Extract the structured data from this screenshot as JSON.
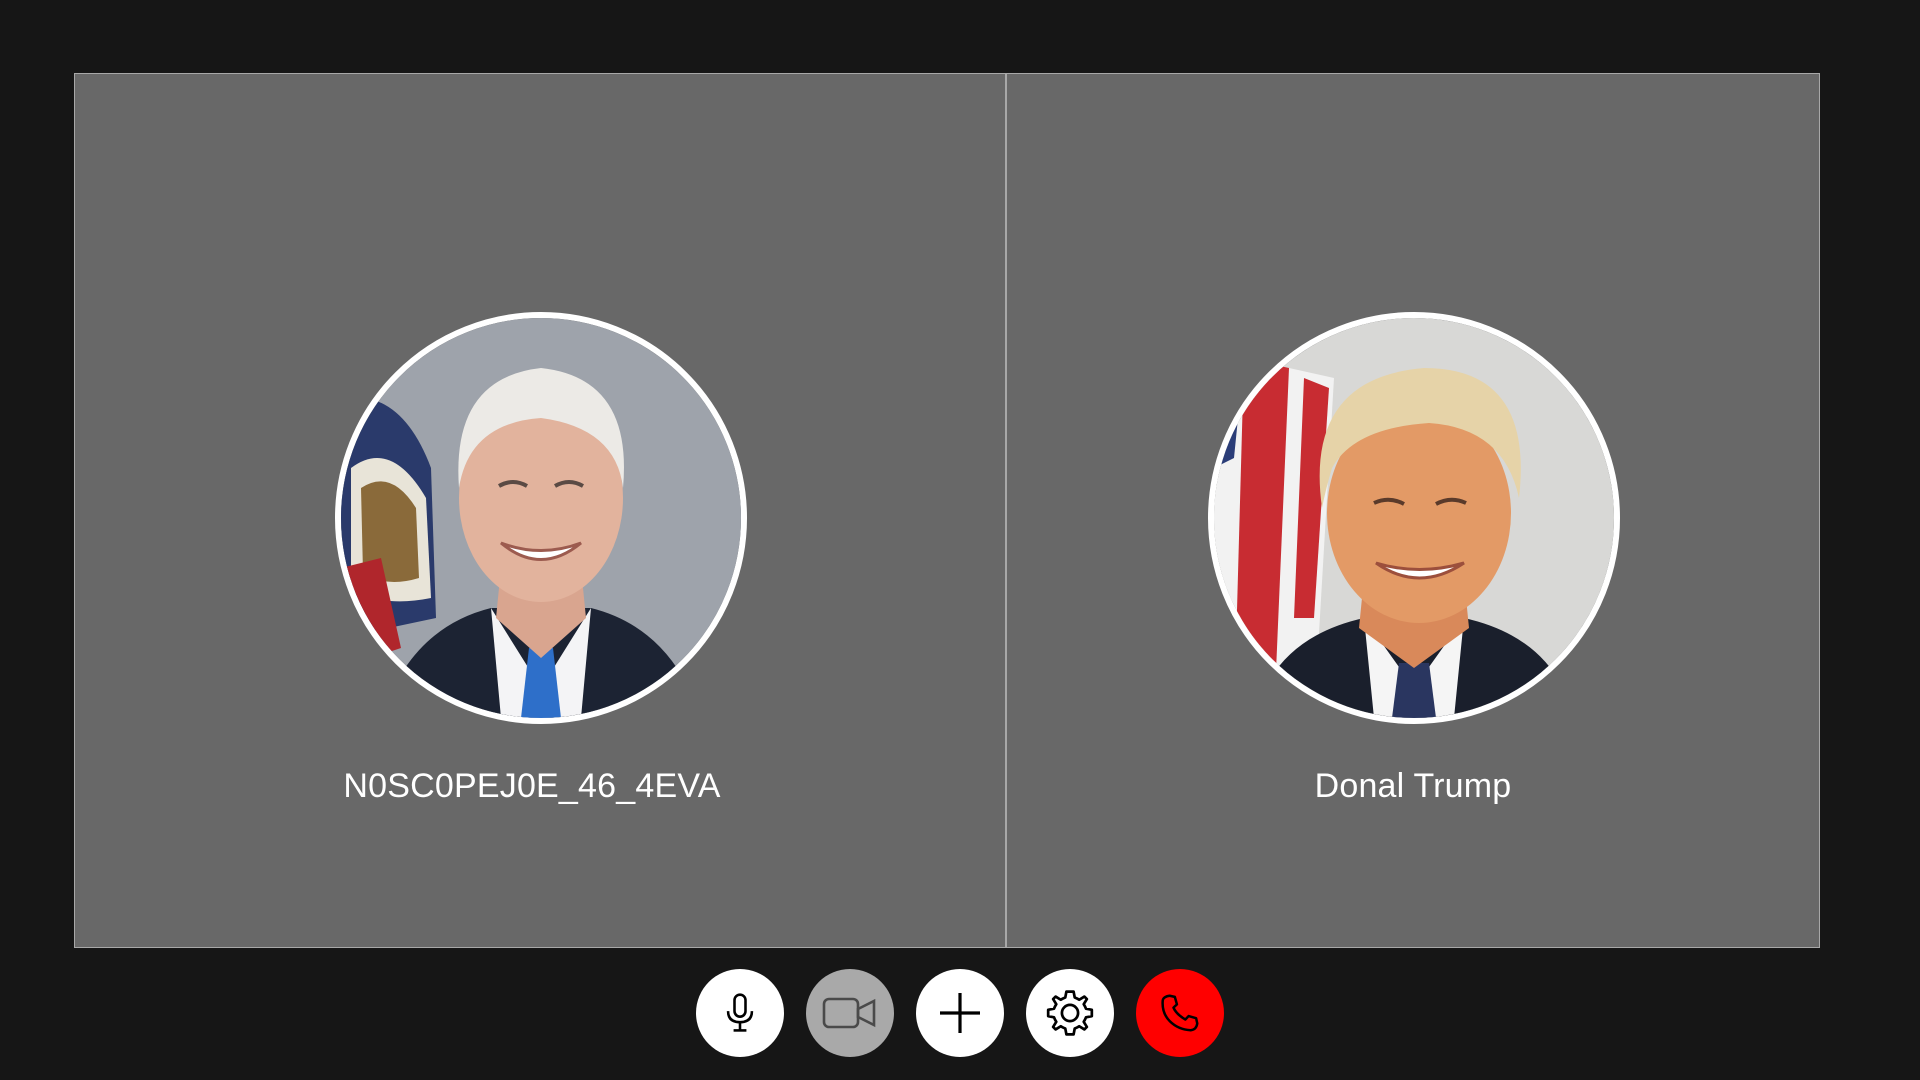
{
  "participants": [
    {
      "name": "N0SC0PEJ0E_46_4EVA",
      "avatar_icon": "user-avatar-photo"
    },
    {
      "name": "Donal Trump",
      "avatar_icon": "user-avatar-photo"
    }
  ],
  "controls": [
    {
      "id": "mute",
      "icon": "microphone-icon",
      "state": "on"
    },
    {
      "id": "camera",
      "icon": "video-camera-icon",
      "state": "off"
    },
    {
      "id": "add",
      "icon": "plus-icon",
      "state": "on"
    },
    {
      "id": "settings",
      "icon": "gear-icon",
      "state": "on"
    },
    {
      "id": "end-call",
      "icon": "phone-hangup-icon",
      "state": "end"
    }
  ],
  "colors": {
    "background": "#161616",
    "tile": "#686868",
    "end_call": "#ff0000",
    "camera_off": "#a9a9a9"
  }
}
